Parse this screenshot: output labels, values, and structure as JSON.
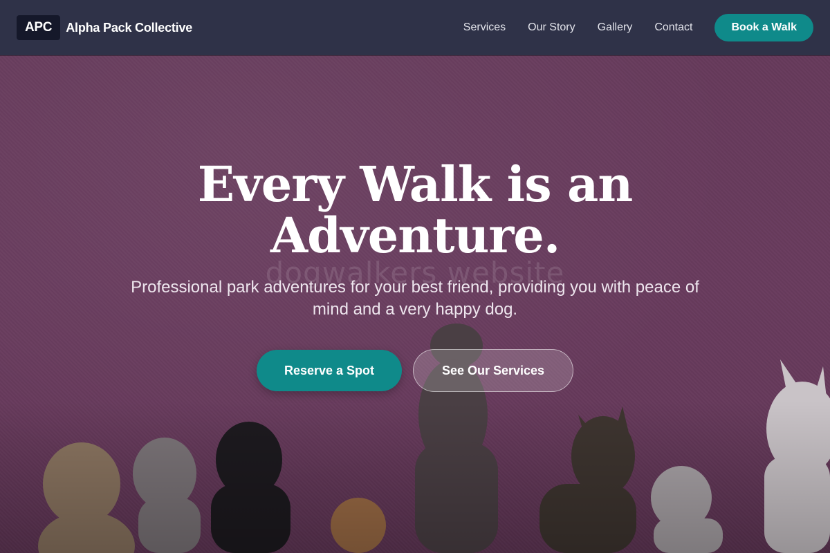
{
  "brand": {
    "badge": "APC",
    "name": "Alpha Pack Collective"
  },
  "nav": {
    "links": [
      "Services",
      "Our Story",
      "Gallery",
      "Contact"
    ],
    "cta": "Book a Walk"
  },
  "hero": {
    "title_line1": "Every Walk is an",
    "title_line2": "Adventure.",
    "watermark": "dogwalkers website",
    "subtitle": "Professional park adventures for your best friend, providing you with peace of mind and a very happy dog.",
    "primary_cta": "Reserve a Spot",
    "secondary_cta": "See Our Services"
  },
  "colors": {
    "nav_bg": "#2f3248",
    "accent": "#0f8a8a",
    "hero_wall": "#6e3e61"
  },
  "icons": {
    "background_image": "dogs-against-pink-wall-photo"
  }
}
